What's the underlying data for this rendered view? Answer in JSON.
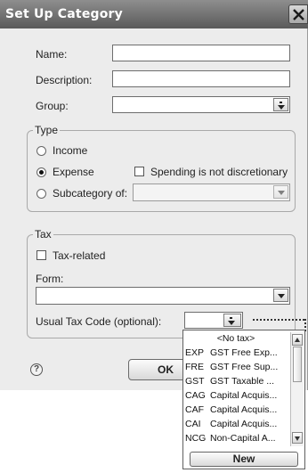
{
  "window": {
    "title": "Set Up Category"
  },
  "fields": {
    "name_label": "Name:",
    "name_value": "",
    "description_label": "Description:",
    "description_value": "",
    "group_label": "Group:",
    "group_value": ""
  },
  "type": {
    "title": "Type",
    "income_label": "Income",
    "expense_label": "Expense",
    "spending_label": "Spending is not discretionary",
    "subcategory_label": "Subcategory of:",
    "selected": "expense"
  },
  "tax": {
    "title": "Tax",
    "tax_related_label": "Tax-related",
    "form_label": "Form:",
    "form_value": "",
    "usual_code_label": "Usual Tax Code (optional):",
    "usual_code_value": ""
  },
  "buttons": {
    "help": "?",
    "ok": "OK",
    "new": "New"
  },
  "tax_codes": [
    {
      "code": "",
      "desc": "<No tax>"
    },
    {
      "code": "EXP",
      "desc": "GST Free Exp..."
    },
    {
      "code": "FRE",
      "desc": "GST Free Sup..."
    },
    {
      "code": "GST",
      "desc": "GST Taxable ..."
    },
    {
      "code": "CAG",
      "desc": "Capital Acquis..."
    },
    {
      "code": "CAF",
      "desc": "Capital Acquis..."
    },
    {
      "code": "CAI",
      "desc": "Capital Acquis..."
    },
    {
      "code": "NCG",
      "desc": "Non-Capital A..."
    }
  ]
}
